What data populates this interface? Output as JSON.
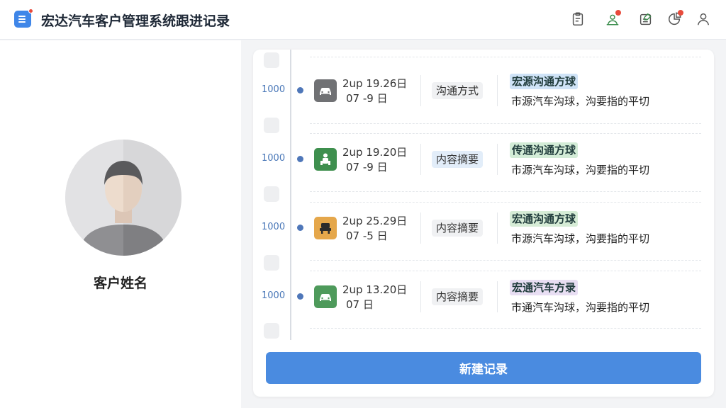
{
  "header": {
    "title": "宏达汽车客户管理系统跟进记录",
    "icons": [
      "clipboard-icon",
      "person-pin-icon",
      "edit-note-icon",
      "pie-chart-icon",
      "user-icon"
    ]
  },
  "customer": {
    "name": "客户姓名"
  },
  "records": [
    {
      "num": "1000",
      "date_line1": "2up 19.26日",
      "date_line2": "07 -9 日",
      "thumb_icon": "car-icon",
      "thumb_color": "#707174",
      "tag": "沟通方式",
      "highlight": "宏源沟通方球",
      "highlight_color": "#cfe3f7",
      "desc": "市源汽车沟球，沟要指的平切"
    },
    {
      "num": "1000",
      "date_line1": "2up 19.20日",
      "date_line2": "07 -9 日",
      "thumb_icon": "person-icon",
      "thumb_color": "#3e8f4e",
      "tag": "内容摘要",
      "highlight": "传通沟通方球",
      "highlight_color": "#d3ecd7",
      "desc": "市源汽车沟球，沟要指的平切"
    },
    {
      "num": "1000",
      "date_line1": "2up 25.29日",
      "date_line2": "07 -5 日",
      "thumb_icon": "seat-icon",
      "thumb_color": "#e5a74b",
      "tag": "内容摘要",
      "highlight": "宏通沟通方球",
      "highlight_color": "#d6ecd6",
      "desc": "市源汽车沟球，沟要指的平切"
    },
    {
      "num": "1000",
      "date_line1": "2up 13.20日",
      "date_line2": "07 日",
      "thumb_icon": "car-icon",
      "thumb_color": "#4e9a5b",
      "tag": "内容摘要",
      "highlight": "宏通汽车方录",
      "highlight_color": "#e8def3",
      "desc": "市通汽车沟球，沟要指的平切"
    }
  ],
  "actions": {
    "new_record": "新建记录"
  },
  "colors": {
    "accent": "#4a8be0",
    "timeline_dot": "#4f77b9"
  }
}
